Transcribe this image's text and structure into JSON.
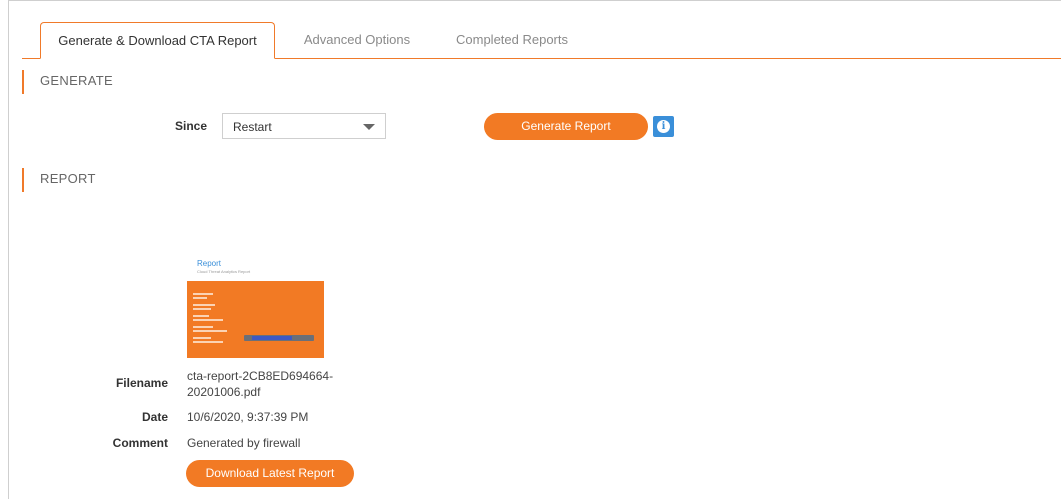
{
  "tabs": [
    {
      "label": "Generate & Download CTA Report"
    },
    {
      "label": "Advanced Options"
    },
    {
      "label": "Completed Reports"
    }
  ],
  "generate": {
    "heading": "GENERATE",
    "since_label": "Since",
    "since_value": "Restart",
    "button_label": "Generate Report",
    "info_glyph": "i"
  },
  "report": {
    "heading": "REPORT",
    "thumbnail": {
      "title": "Report",
      "subtitle": "Cloud Threat Analytics Report"
    },
    "filename_label": "Filename",
    "filename_line1": "cta-report-2CB8ED694664-",
    "filename_line2": "20201006.pdf",
    "date_label": "Date",
    "date_value": "10/6/2020, 9:37:39 PM",
    "comment_label": "Comment",
    "comment_value": "Generated by firewall",
    "download_label": "Download Latest Report"
  },
  "colors": {
    "accent": "#f27a24",
    "info": "#3a8fd9"
  }
}
